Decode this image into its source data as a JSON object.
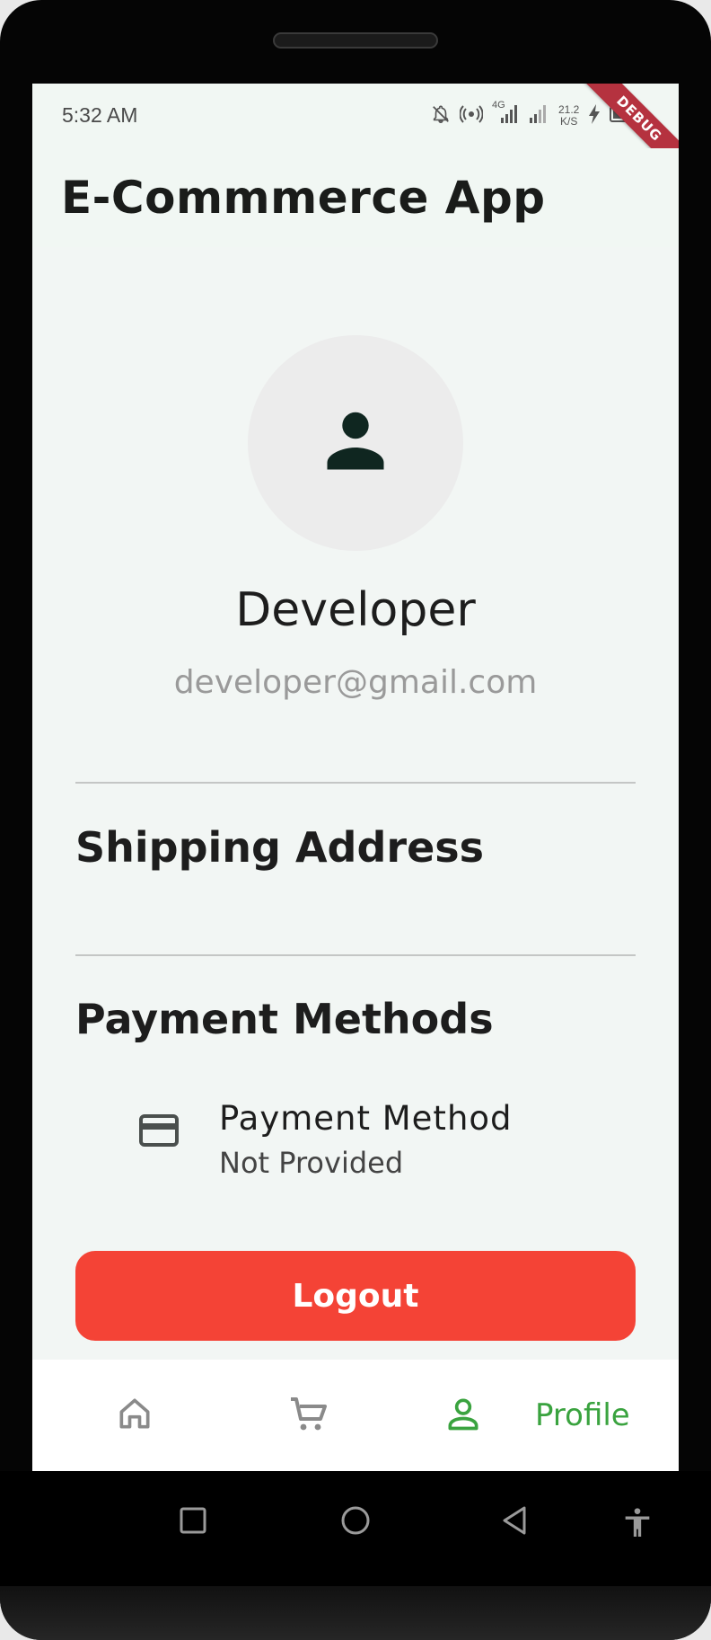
{
  "status_bar": {
    "time": "5:32 AM",
    "network_type": "4G",
    "net_speed_value": "21.2",
    "net_speed_unit": "K/S",
    "icons": [
      "mute-icon",
      "hotspot-icon",
      "signal-icon",
      "signal-icon",
      "charging-icon",
      "battery-icon"
    ]
  },
  "debug_banner": "DEBUG",
  "app_bar": {
    "title": "E-Commmerce App"
  },
  "profile": {
    "name": "Developer",
    "email": "developer@gmail.com",
    "avatar_icon": "person-icon"
  },
  "sections": {
    "shipping_title": "Shipping Address",
    "payment_title": "Payment Methods"
  },
  "payment_method": {
    "icon": "credit-card-icon",
    "title": "Payment Method",
    "subtitle": "Not Provided"
  },
  "logout_label": "Logout",
  "bottom_nav": {
    "items": [
      {
        "icon": "home-icon",
        "label": "",
        "active": false
      },
      {
        "icon": "cart-icon",
        "label": "",
        "active": false
      },
      {
        "icon": "person-outline-icon",
        "label": "Profile",
        "active": true
      }
    ]
  },
  "colors": {
    "accent_green": "#3aa33f",
    "logout_red": "#f44336",
    "background": "#f2f6f4",
    "debug_ribbon": "#b5323f"
  },
  "system_nav": [
    "recents-square-icon",
    "home-circle-icon",
    "back-triangle-icon",
    "accessibility-icon"
  ]
}
